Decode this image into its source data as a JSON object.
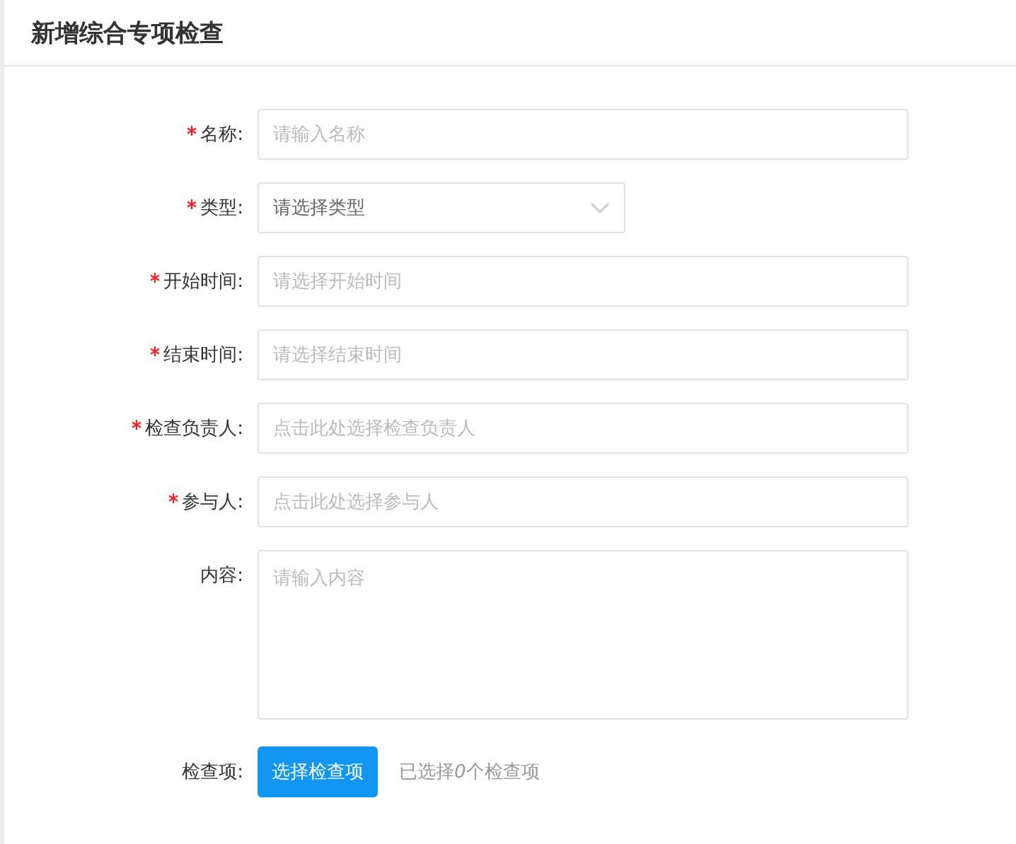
{
  "title": "新增综合专项检查",
  "fields": [
    {
      "label": "名称:",
      "required": true,
      "kind": "text",
      "placeholder": "请输入名称"
    },
    {
      "label": "类型:",
      "required": true,
      "kind": "select",
      "placeholder": "请选择类型"
    },
    {
      "label": "开始时间:",
      "required": true,
      "kind": "text",
      "placeholder": "请选择开始时间"
    },
    {
      "label": "结束时间:",
      "required": true,
      "kind": "text",
      "placeholder": "请选择结束时间"
    },
    {
      "label": "检查负责人:",
      "required": true,
      "kind": "text",
      "placeholder": "点击此处选择检查负责人"
    },
    {
      "label": "参与人:",
      "required": true,
      "kind": "text",
      "placeholder": "点击此处选择参与人"
    },
    {
      "label": "内容:",
      "required": false,
      "kind": "textarea",
      "placeholder": "请输入内容"
    }
  ],
  "check_items": {
    "label": "检查项:",
    "button": "选择检查项",
    "summary": {
      "before": "已选择",
      "count": "0",
      "after": "个检查项"
    }
  }
}
